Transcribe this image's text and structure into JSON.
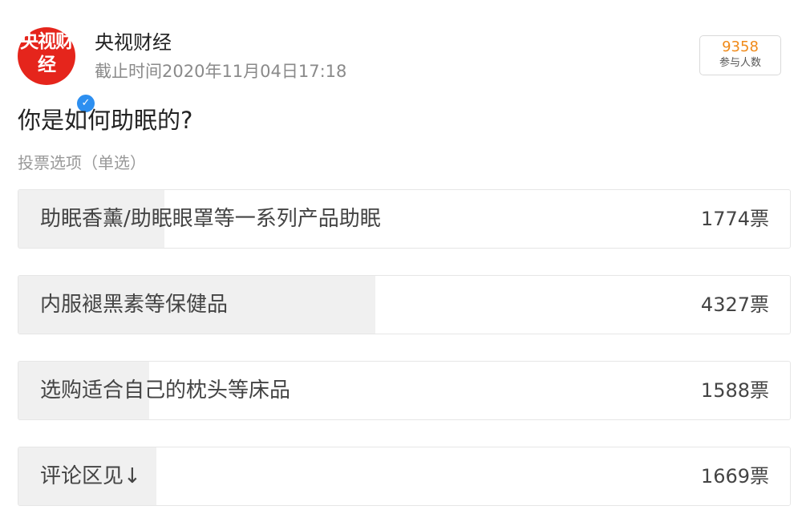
{
  "account": {
    "avatar_text": "央视财经",
    "avatar_color": "#e5251c",
    "verified_icon": "verified-check-icon",
    "name": "央视财经",
    "deadline": "截止时间2020年11月04日17:18"
  },
  "participants": {
    "count": "9358",
    "label": "参与人数"
  },
  "poll": {
    "question": "你是如何助眠的?",
    "type_label": "投票选项（单选）",
    "options": [
      {
        "label": "助眠香薰/助眠眼罩等一系列产品助眠",
        "votes": "1774票",
        "vote_count": 1774
      },
      {
        "label": "内服褪黑素等保健品",
        "votes": "4327票",
        "vote_count": 4327
      },
      {
        "label": "选购适合自己的枕头等床品",
        "votes": "1588票",
        "vote_count": 1588
      },
      {
        "label": "评论区见↓",
        "votes": "1669票",
        "vote_count": 1669
      }
    ]
  }
}
